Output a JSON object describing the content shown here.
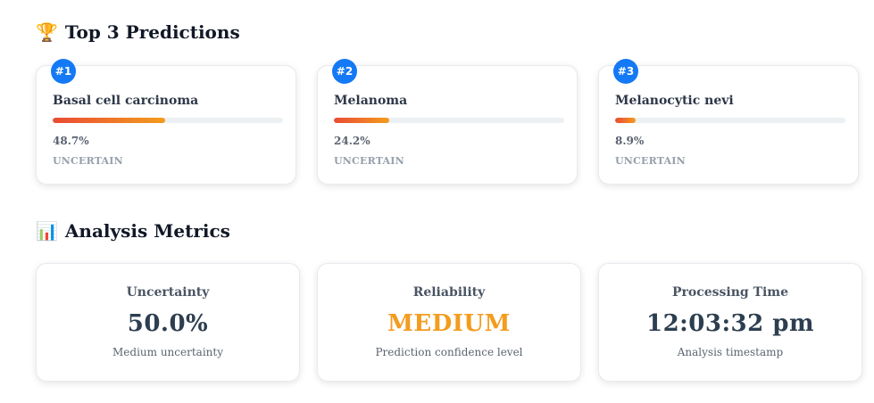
{
  "sections": {
    "predictions": {
      "icon": "trophy-icon",
      "emoji": "🏆",
      "title": "Top 3 Predictions"
    },
    "metrics": {
      "icon": "bar-chart-icon",
      "emoji": "📊",
      "title": "Analysis Metrics"
    }
  },
  "predictions": [
    {
      "rank": "#1",
      "name": "Basal cell carcinoma",
      "percent": "48.7%",
      "fraction": 0.487,
      "status": "UNCERTAIN"
    },
    {
      "rank": "#2",
      "name": "Melanoma",
      "percent": "24.2%",
      "fraction": 0.242,
      "status": "UNCERTAIN"
    },
    {
      "rank": "#3",
      "name": "Melanocytic nevi",
      "percent": "8.9%",
      "fraction": 0.089,
      "status": "UNCERTAIN"
    }
  ],
  "metrics": [
    {
      "label": "Uncertainty",
      "value": "50.0%",
      "sub": "Medium uncertainty",
      "color": "#2c3e50"
    },
    {
      "label": "Reliability",
      "value": "MEDIUM",
      "sub": "Prediction confidence level",
      "color": "#f39c1e"
    },
    {
      "label": "Processing Time",
      "value": "12:03:32 pm",
      "sub": "Analysis timestamp",
      "color": "#2c3e50"
    }
  ],
  "colors": {
    "badge": "#1479f5",
    "bar_start": "#e94b35",
    "bar_end": "#f39c1e"
  }
}
